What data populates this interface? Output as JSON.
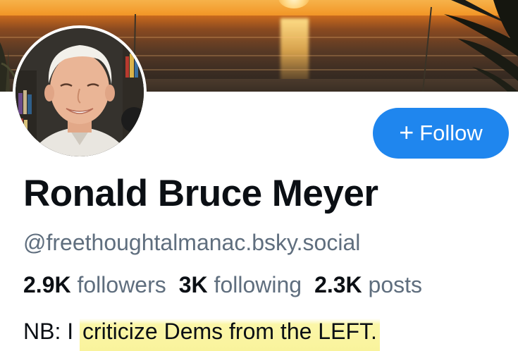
{
  "profile": {
    "display_name": "Ronald Bruce Meyer",
    "handle": "@freethoughtalmanac.bsky.social",
    "bio_prefix": "NB: I",
    "bio_highlight": "criticize Dems from the LEFT."
  },
  "stats": [
    {
      "value": "2.9K",
      "label": "followers"
    },
    {
      "value": "3K",
      "label": "following"
    },
    {
      "value": "2.3K",
      "label": "posts"
    }
  ],
  "actions": {
    "follow_label": "Follow",
    "follow_icon": "plus-icon"
  },
  "colors": {
    "follow_button": "#1f86ee",
    "secondary_text": "#5f6e7e",
    "highlight": "#f9f39c"
  }
}
